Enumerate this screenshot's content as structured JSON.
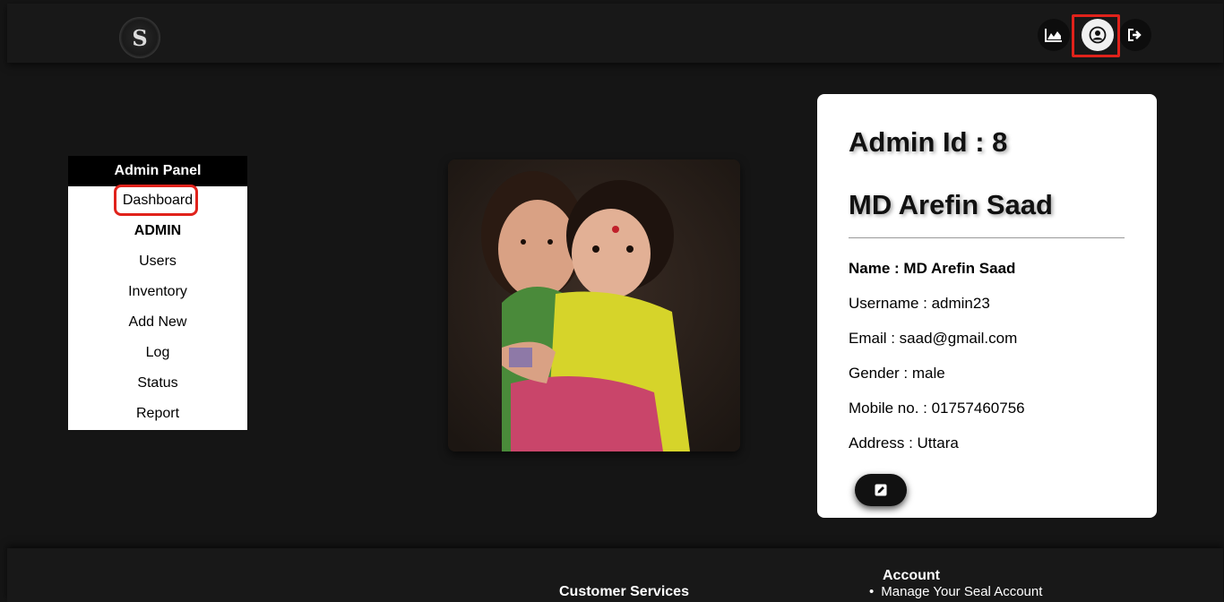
{
  "header": {
    "logo_letter": "S",
    "icons": [
      "stats-icon",
      "user-profile-icon",
      "logout-icon"
    ]
  },
  "sidebar": {
    "title": "Admin Panel",
    "items": [
      {
        "label": "Dashboard"
      },
      {
        "label": "ADMIN",
        "active": true
      },
      {
        "label": "Users"
      },
      {
        "label": "Inventory"
      },
      {
        "label": "Add New"
      },
      {
        "label": "Log"
      },
      {
        "label": "Status"
      },
      {
        "label": "Report"
      }
    ]
  },
  "profile": {
    "admin_id": "Admin Id : 8",
    "full_name": "MD Arefin Saad",
    "fields": {
      "name": "Name : MD Arefin Saad",
      "username": "Username : admin23",
      "email": "Email : saad@gmail.com",
      "gender": "Gender : male",
      "mobile": "Mobile no. : 01757460756",
      "address": "Address : Uttara"
    },
    "edit_icon": "edit-icon"
  },
  "footer": {
    "customer_services": "Customer Services",
    "account_heading": "Account",
    "account_items": [
      "Manage Your Seal Account"
    ]
  },
  "colors": {
    "background": "#151515",
    "highlight": "#e0221b",
    "card": "#ffffff"
  }
}
